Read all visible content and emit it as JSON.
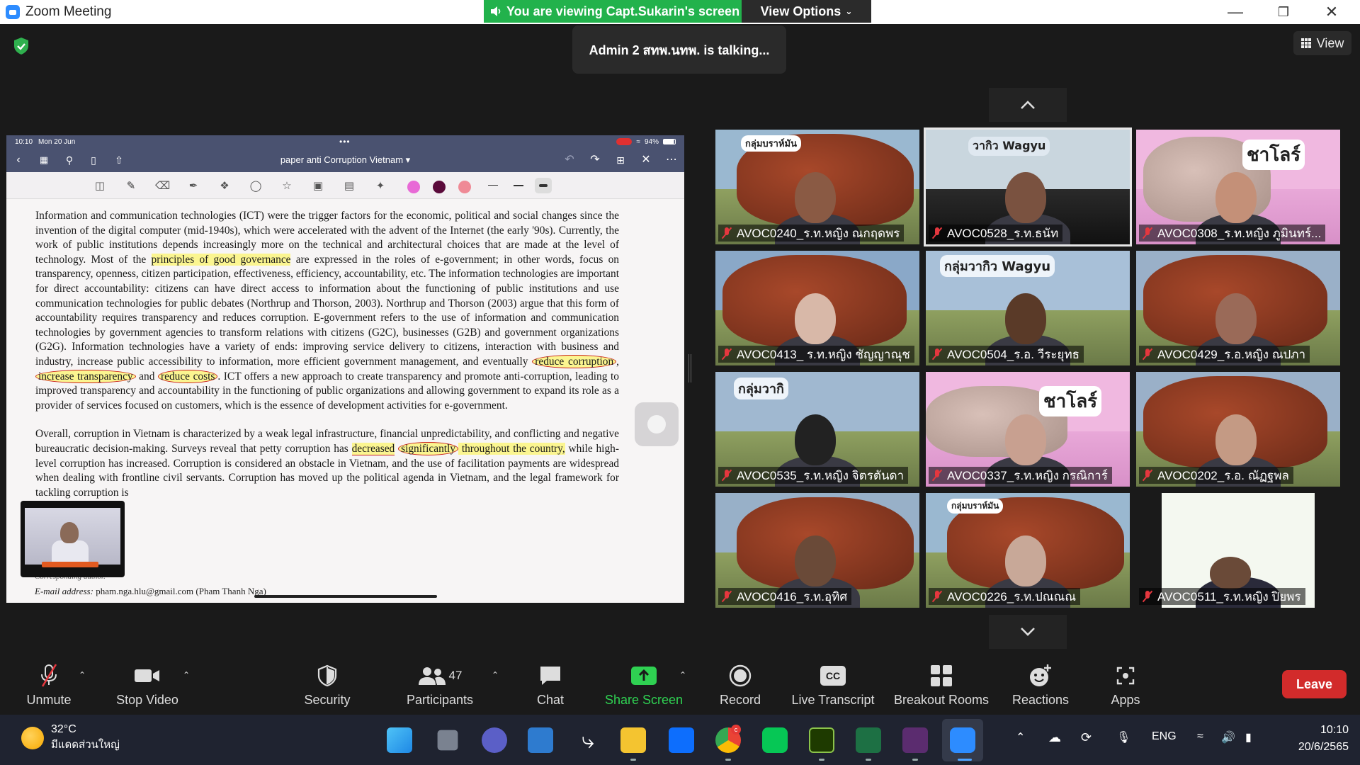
{
  "window": {
    "title": "Zoom Meeting",
    "viewing_banner": "You are viewing Capt.Sukarin's screen",
    "view_options": "View Options",
    "minimize": "—",
    "maximize": "❐",
    "close": "✕"
  },
  "meeting": {
    "talking": "Admin 2 สทพ.นทพ. is talking...",
    "view_label": "View"
  },
  "shared_screen": {
    "status_time": "10:10",
    "status_date": "Mon 20 Jun",
    "status_dots": "•••",
    "battery": "94%",
    "doc_title": "paper anti Corruption Vietnam",
    "ink_colors": [
      "#e86ad6",
      "#5a0a3a",
      "#ef8a96"
    ],
    "paragraph1": {
      "a": "Information and communication technologies (ICT) were the trigger factors for the economic, political and social changes since the invention of the digital computer (mid-1940s), which were accelerated with the advent of the Internet (the early '90s). Currently, the work of public institutions depends increasingly more on the technical and architectural choices that are made at the level of technology. Most of the ",
      "hl1": "principles of good governance",
      "b": " are expressed in the roles of e-government; in other words, focus on transparency, openness, citizen participation, effectiveness, efficiency, accountability, etc. The information technologies are important for direct accountability: citizens can have direct access to information about the functioning of public institutions and use communication technologies for public debates (Northrup and Thorson, 2003). Northrup and Thorson (2003) argue that this form of accountability requires transparency and reduces corruption. E-government refers to the use of information and communication technologies by government agencies to transform relations with citizens (G2C), businesses (G2B) and government organizations (G2G). Information technologies have a variety of ends: improving service delivery to citizens, interaction with business and industry, increase public accessibility to information, more efficient government management, and eventually ",
      "c1": "reduce corruption",
      "sep1": ", ",
      "c2": "increase transparency",
      "sep2": " and ",
      "c3": "reduce costs",
      "c": ". ICT offers a new approach to create transparency and promote anti-corruption, leading to improved transparency and accountability in the functioning of public organizations and allowing government to expand its role as a provider of services focused on customers, which is the essence of development activities for e-government."
    },
    "paragraph2": {
      "a": "Overall, corruption in Vietnam is characterized by a weak legal infrastructure, financial unpredictability, and conflicting and negative bureaucratic decision-making. Surveys reveal that petty corruption has ",
      "hl1": "decreased",
      "sp": " ",
      "c1": "significantly",
      "hl2": " throughout the country,",
      "b": " while high-level corruption has increased. Corruption is considered an obstacle in Vietnam, and the use of facilitation payments are widespread when dealing with frontline civil servants. Corruption has moved up the political agenda in Vietnam, and the legal framework for tackling corruption is"
    },
    "footer_label": "E-mail address:",
    "footer_text": " pham.nga.hlu@gmail.com (Pham Thanh Nga)",
    "corresponding": "Corresponding author."
  },
  "participants_tiles": [
    {
      "name": "AVOC0240_ร.ท.หญิง ณกฤดพร",
      "tag": "กลุ่มบราห์มัน"
    },
    {
      "name": "AVOC0528_ร.ท.ธนัท",
      "tag": "วากิว Wagyu"
    },
    {
      "name": "AVOC0308_ร.ท.หญิง ภูมินทร์...",
      "tag": "ชาโลร์"
    },
    {
      "name": "AVOC0413_ ร.ท.หญิง ชัญญาณุช",
      "tag": ""
    },
    {
      "name": "AVOC0504_ร.อ. วีระยุทธ",
      "tag": "กลุ่มวากิว Wagyu"
    },
    {
      "name": "AVOC0429_ร.อ.หญิง ณปภา",
      "tag": ""
    },
    {
      "name": "AVOC0535_ร.ท.หญิง จิตรตันดา",
      "tag": "กลุ่มวากิ"
    },
    {
      "name": "AVOC0337_ร.ท.หญิง กรณิการ์",
      "tag": "ชาโลร์"
    },
    {
      "name": "AVOC0202_ร.อ. ณัฏฐพล",
      "tag": ""
    },
    {
      "name": "AVOC0416_ร.ท.อุทิศ",
      "tag": ""
    },
    {
      "name": "AVOC0226_ร.ท.ปณณณ",
      "tag": "กลุ่มบราห์มัน"
    },
    {
      "name": "AVOC0511_ร.ท.หญิง ปิยพร",
      "tag": ""
    }
  ],
  "toolbar": {
    "unmute": "Unmute",
    "stop_video": "Stop Video",
    "security": "Security",
    "participants": "Participants",
    "participants_count": "47",
    "chat": "Chat",
    "share_screen": "Share Screen",
    "record": "Record",
    "live_transcript": "Live Transcript",
    "breakout_rooms": "Breakout Rooms",
    "reactions": "Reactions",
    "apps": "Apps",
    "leave": "Leave",
    "cc": "CC"
  },
  "taskbar": {
    "temperature": "32°C",
    "weather_desc": "มีแดดส่วนใหญ่",
    "language": "ENG",
    "time": "10:10",
    "date": "20/6/2565",
    "chrome_badge": "c"
  }
}
